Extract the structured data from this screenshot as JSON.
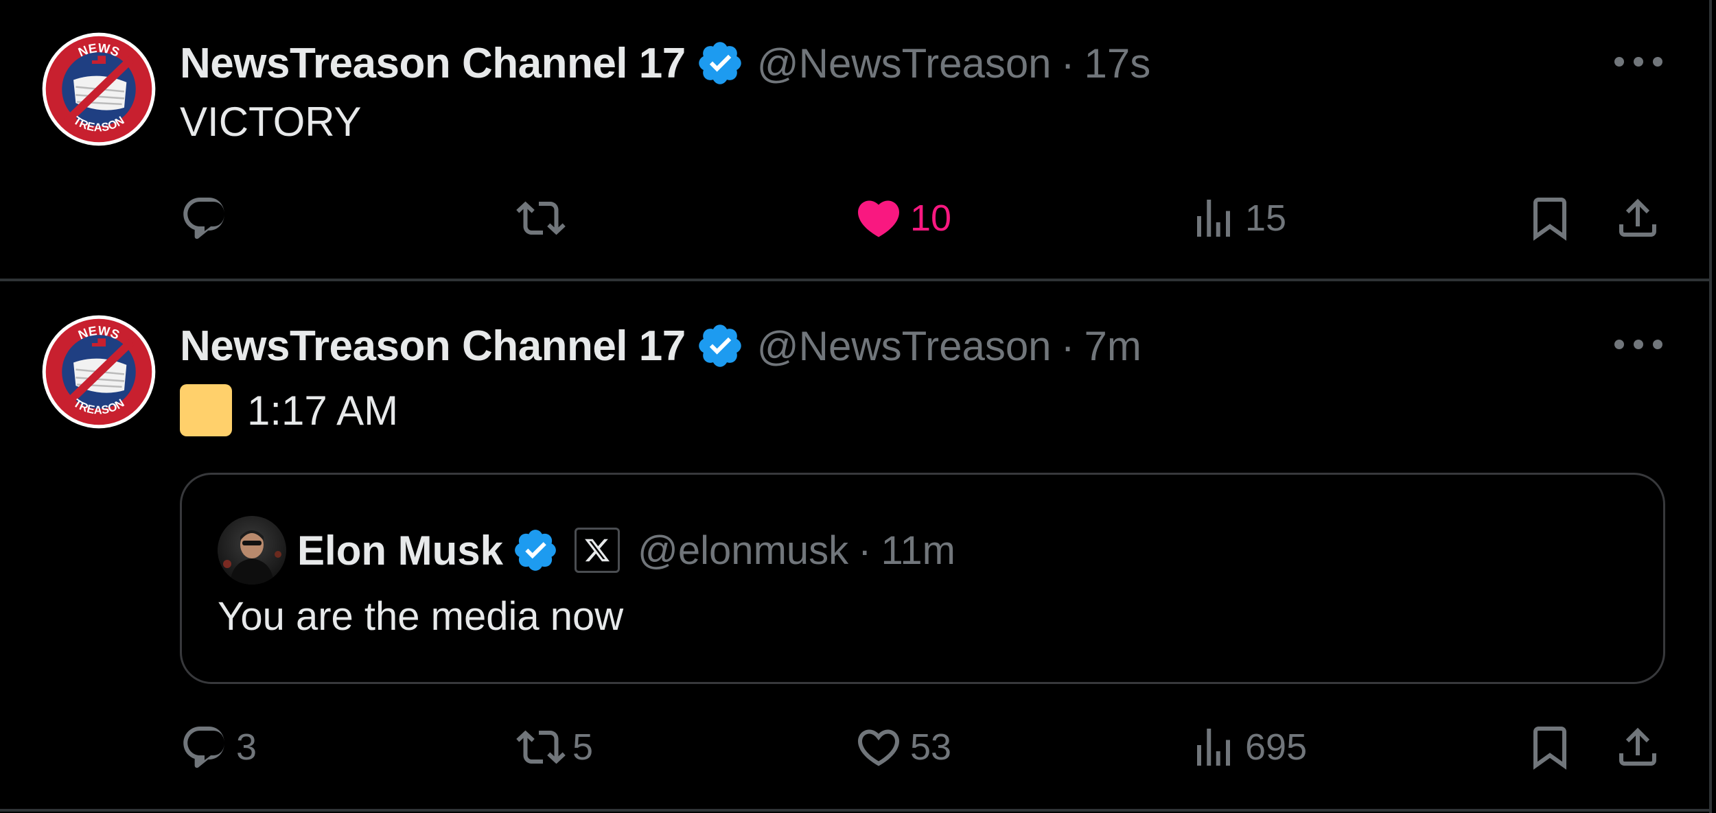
{
  "colors": {
    "background": "#000000",
    "text_primary": "#e7e9ea",
    "text_secondary": "#71767b",
    "verified_blue": "#1d9bf0",
    "like_pink": "#f91880",
    "border": "#2f3336",
    "yellow_square": "#ffd06b"
  },
  "tweets": [
    {
      "author": {
        "name": "NewsTreason Channel 17",
        "handle": "@NewsTreason",
        "verified": true,
        "avatar_icon": "newstreason-logo-icon",
        "avatar_logo_text": [
          "NEWS",
          "TREASON"
        ]
      },
      "separator": "·",
      "time": "17s",
      "text": "VICTORY",
      "actions": {
        "reply": {
          "icon": "reply-icon",
          "count": ""
        },
        "retweet": {
          "icon": "retweet-icon",
          "count": ""
        },
        "like": {
          "icon": "heart-filled-icon",
          "count": "10",
          "liked": true
        },
        "views": {
          "icon": "views-icon",
          "count": "15"
        },
        "bookmark": {
          "icon": "bookmark-icon"
        },
        "share": {
          "icon": "share-icon"
        }
      }
    },
    {
      "author": {
        "name": "NewsTreason Channel 17",
        "handle": "@NewsTreason",
        "verified": true,
        "avatar_icon": "newstreason-logo-icon",
        "avatar_logo_text": [
          "NEWS",
          "TREASON"
        ]
      },
      "separator": "·",
      "time": "7m",
      "text": "1:17 AM",
      "text_prefix_icon": "yellow-square-icon",
      "quote": {
        "author": {
          "name": "Elon Musk",
          "handle": "@elonmusk",
          "verified": true,
          "affiliation_badge": "x-logo-icon"
        },
        "separator": "·",
        "time": "11m",
        "text": "You are the media now"
      },
      "actions": {
        "reply": {
          "icon": "reply-icon",
          "count": "3"
        },
        "retweet": {
          "icon": "retweet-icon",
          "count": "5"
        },
        "like": {
          "icon": "heart-icon",
          "count": "53",
          "liked": false
        },
        "views": {
          "icon": "views-icon",
          "count": "695"
        },
        "bookmark": {
          "icon": "bookmark-icon"
        },
        "share": {
          "icon": "share-icon"
        }
      }
    }
  ]
}
